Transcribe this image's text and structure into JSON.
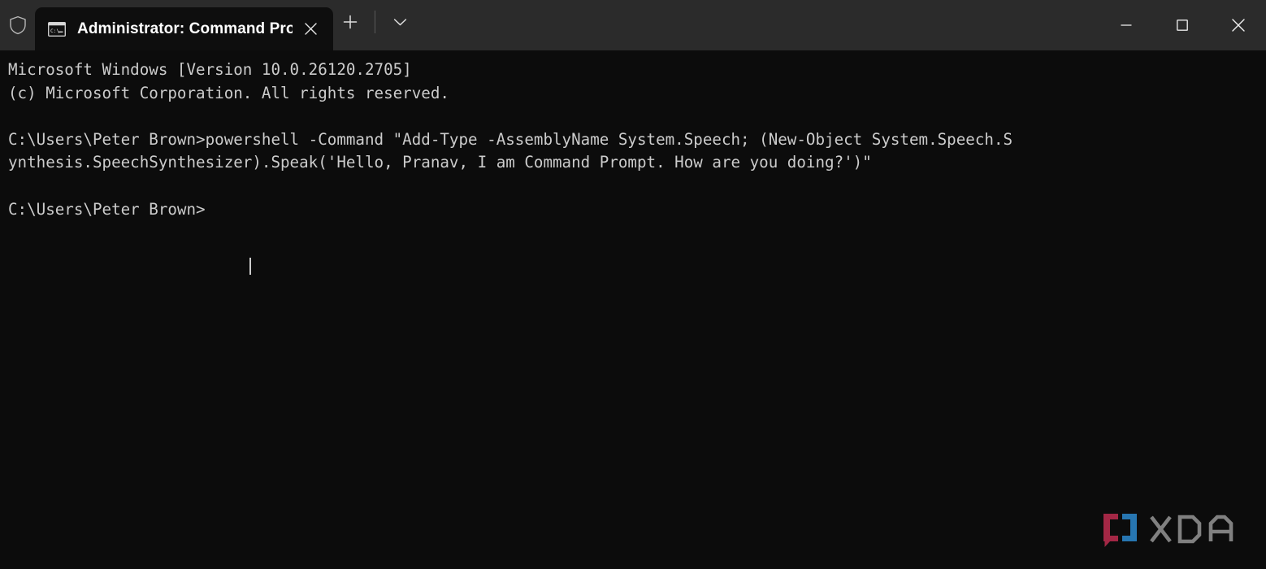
{
  "window": {
    "title": "Administrator: Command Pro",
    "colors": {
      "titlebar_bg": "#2b2b2b",
      "tab_bg": "#0e0e0e",
      "terminal_bg": "#0c0c0c",
      "terminal_fg": "#cccccc",
      "title_fg": "#ffffff",
      "icon_fg": "#c8c8c8",
      "xda_red": "#b02a4a",
      "xda_blue": "#2a7fc0",
      "xda_gray": "#8a8a8a"
    }
  },
  "titlebar": {
    "shield_icon": "shield-icon",
    "tab": {
      "icon": "command-prompt-icon",
      "title": "Administrator: Command Pro",
      "close_icon": "close-icon",
      "close_label": "×"
    },
    "new_tab_icon": "plus-icon",
    "new_tab_label": "+",
    "dropdown_icon": "chevron-down-icon",
    "controls": {
      "minimize_icon": "minimize-icon",
      "minimize_label": "—",
      "maximize_icon": "maximize-icon",
      "close_icon": "close-window-icon",
      "close_label": "✕"
    }
  },
  "terminal": {
    "lines": [
      "Microsoft Windows [Version 10.0.26120.2705]",
      "(c) Microsoft Corporation. All rights reserved.",
      "",
      "C:\\Users\\Peter Brown>powershell -Command \"Add-Type -AssemblyName System.Speech; (New-Object System.Speech.S",
      "ynthesis.SpeechSynthesizer).Speak('Hello, Pranav, I am Command Prompt. How are you doing?')\"",
      "",
      "C:\\Users\\Peter Brown>"
    ],
    "text": "Microsoft Windows [Version 10.0.26120.2705]\n(c) Microsoft Corporation. All rights reserved.\n\nC:\\Users\\Peter Brown>powershell -Command \"Add-Type -AssemblyName System.Speech; (New-Object System.Speech.S\nynthesis.SpeechSynthesizer).Speak('Hello, Pranav, I am Command Prompt. How are you doing?')\"\n\nC:\\Users\\Peter Brown>",
    "prompt": "C:\\Users\\Peter Brown>",
    "cursor_visible": true
  },
  "watermark": {
    "text": "XDA",
    "mark_icon": "xda-bracket-logo"
  }
}
